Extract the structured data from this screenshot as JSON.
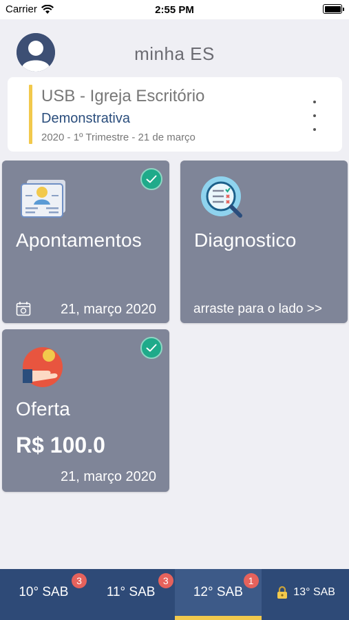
{
  "status_bar": {
    "carrier": "Carrier",
    "time": "2:55 PM"
  },
  "header": {
    "title": "minha ES"
  },
  "info_card": {
    "title": "USB - Igreja Escritório",
    "subtitle": "Demonstrativa",
    "meta": "2020 - 1º Trimestre - 21 de março"
  },
  "tiles": {
    "apontamentos": {
      "title": "Apontamentos",
      "date": "21, março 2020",
      "checked": true
    },
    "diagnostico": {
      "title": "Diagnostico",
      "hint": "arraste para o lado >>"
    },
    "oferta": {
      "title": "Oferta",
      "amount": "R$ 100.0",
      "date": "21, março 2020",
      "checked": true
    }
  },
  "tabs": [
    {
      "label": "10° SAB",
      "badge": "3",
      "active": false,
      "locked": false
    },
    {
      "label": "11° SAB",
      "badge": "3",
      "active": false,
      "locked": false
    },
    {
      "label": "12° SAB",
      "badge": "1",
      "active": true,
      "locked": false
    },
    {
      "label": "13° SAB",
      "badge": "",
      "active": false,
      "locked": true
    }
  ],
  "colors": {
    "tile": "#7f8598",
    "accent": "#f2c94c",
    "check": "#1faa8a",
    "tabbar": "#2e4a77",
    "badge": "#e5625c",
    "subtitle": "#2a4d7c"
  }
}
